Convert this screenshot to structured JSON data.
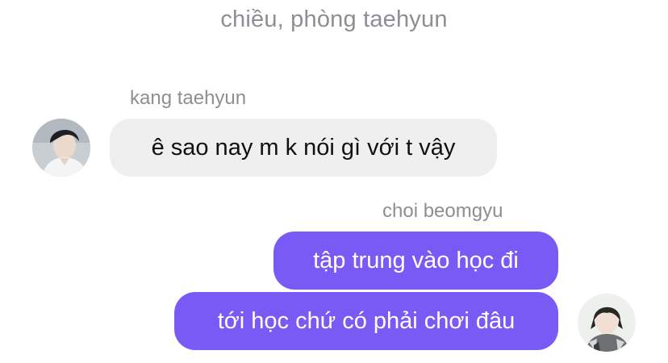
{
  "header": {
    "timestamp": "chiều, phòng taehyun"
  },
  "conversation": {
    "messages": [
      {
        "sender": "kang taehyun",
        "direction": "incoming",
        "text": "ê sao nay m k nói gì với t vậy",
        "avatar_icon": "profile-photo-icon"
      },
      {
        "sender": "choi beomgyu",
        "direction": "outgoing",
        "text": "tập trung vào học đi"
      },
      {
        "sender": "choi beomgyu",
        "direction": "outgoing",
        "text": "tới học chứ có phải chơi đâu",
        "avatar_icon": "profile-photo-icon"
      }
    ]
  },
  "colors": {
    "incoming_bubble": "#efefef",
    "outgoing_bubble": "#7a5af5",
    "meta_text": "#8e8e93"
  }
}
